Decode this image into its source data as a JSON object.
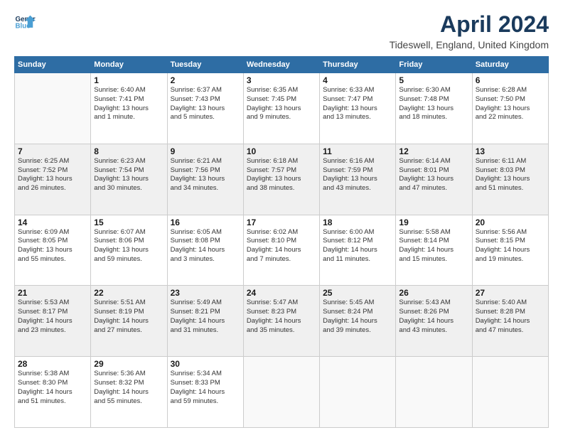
{
  "header": {
    "logo_line1": "General",
    "logo_line2": "Blue",
    "title": "April 2024",
    "subtitle": "Tideswell, England, United Kingdom"
  },
  "days_of_week": [
    "Sunday",
    "Monday",
    "Tuesday",
    "Wednesday",
    "Thursday",
    "Friday",
    "Saturday"
  ],
  "weeks": [
    [
      {
        "day": "",
        "info": ""
      },
      {
        "day": "1",
        "info": "Sunrise: 6:40 AM\nSunset: 7:41 PM\nDaylight: 13 hours\nand 1 minute."
      },
      {
        "day": "2",
        "info": "Sunrise: 6:37 AM\nSunset: 7:43 PM\nDaylight: 13 hours\nand 5 minutes."
      },
      {
        "day": "3",
        "info": "Sunrise: 6:35 AM\nSunset: 7:45 PM\nDaylight: 13 hours\nand 9 minutes."
      },
      {
        "day": "4",
        "info": "Sunrise: 6:33 AM\nSunset: 7:47 PM\nDaylight: 13 hours\nand 13 minutes."
      },
      {
        "day": "5",
        "info": "Sunrise: 6:30 AM\nSunset: 7:48 PM\nDaylight: 13 hours\nand 18 minutes."
      },
      {
        "day": "6",
        "info": "Sunrise: 6:28 AM\nSunset: 7:50 PM\nDaylight: 13 hours\nand 22 minutes."
      }
    ],
    [
      {
        "day": "7",
        "info": "Sunrise: 6:25 AM\nSunset: 7:52 PM\nDaylight: 13 hours\nand 26 minutes."
      },
      {
        "day": "8",
        "info": "Sunrise: 6:23 AM\nSunset: 7:54 PM\nDaylight: 13 hours\nand 30 minutes."
      },
      {
        "day": "9",
        "info": "Sunrise: 6:21 AM\nSunset: 7:56 PM\nDaylight: 13 hours\nand 34 minutes."
      },
      {
        "day": "10",
        "info": "Sunrise: 6:18 AM\nSunset: 7:57 PM\nDaylight: 13 hours\nand 38 minutes."
      },
      {
        "day": "11",
        "info": "Sunrise: 6:16 AM\nSunset: 7:59 PM\nDaylight: 13 hours\nand 43 minutes."
      },
      {
        "day": "12",
        "info": "Sunrise: 6:14 AM\nSunset: 8:01 PM\nDaylight: 13 hours\nand 47 minutes."
      },
      {
        "day": "13",
        "info": "Sunrise: 6:11 AM\nSunset: 8:03 PM\nDaylight: 13 hours\nand 51 minutes."
      }
    ],
    [
      {
        "day": "14",
        "info": "Sunrise: 6:09 AM\nSunset: 8:05 PM\nDaylight: 13 hours\nand 55 minutes."
      },
      {
        "day": "15",
        "info": "Sunrise: 6:07 AM\nSunset: 8:06 PM\nDaylight: 13 hours\nand 59 minutes."
      },
      {
        "day": "16",
        "info": "Sunrise: 6:05 AM\nSunset: 8:08 PM\nDaylight: 14 hours\nand 3 minutes."
      },
      {
        "day": "17",
        "info": "Sunrise: 6:02 AM\nSunset: 8:10 PM\nDaylight: 14 hours\nand 7 minutes."
      },
      {
        "day": "18",
        "info": "Sunrise: 6:00 AM\nSunset: 8:12 PM\nDaylight: 14 hours\nand 11 minutes."
      },
      {
        "day": "19",
        "info": "Sunrise: 5:58 AM\nSunset: 8:14 PM\nDaylight: 14 hours\nand 15 minutes."
      },
      {
        "day": "20",
        "info": "Sunrise: 5:56 AM\nSunset: 8:15 PM\nDaylight: 14 hours\nand 19 minutes."
      }
    ],
    [
      {
        "day": "21",
        "info": "Sunrise: 5:53 AM\nSunset: 8:17 PM\nDaylight: 14 hours\nand 23 minutes."
      },
      {
        "day": "22",
        "info": "Sunrise: 5:51 AM\nSunset: 8:19 PM\nDaylight: 14 hours\nand 27 minutes."
      },
      {
        "day": "23",
        "info": "Sunrise: 5:49 AM\nSunset: 8:21 PM\nDaylight: 14 hours\nand 31 minutes."
      },
      {
        "day": "24",
        "info": "Sunrise: 5:47 AM\nSunset: 8:23 PM\nDaylight: 14 hours\nand 35 minutes."
      },
      {
        "day": "25",
        "info": "Sunrise: 5:45 AM\nSunset: 8:24 PM\nDaylight: 14 hours\nand 39 minutes."
      },
      {
        "day": "26",
        "info": "Sunrise: 5:43 AM\nSunset: 8:26 PM\nDaylight: 14 hours\nand 43 minutes."
      },
      {
        "day": "27",
        "info": "Sunrise: 5:40 AM\nSunset: 8:28 PM\nDaylight: 14 hours\nand 47 minutes."
      }
    ],
    [
      {
        "day": "28",
        "info": "Sunrise: 5:38 AM\nSunset: 8:30 PM\nDaylight: 14 hours\nand 51 minutes."
      },
      {
        "day": "29",
        "info": "Sunrise: 5:36 AM\nSunset: 8:32 PM\nDaylight: 14 hours\nand 55 minutes."
      },
      {
        "day": "30",
        "info": "Sunrise: 5:34 AM\nSunset: 8:33 PM\nDaylight: 14 hours\nand 59 minutes."
      },
      {
        "day": "",
        "info": ""
      },
      {
        "day": "",
        "info": ""
      },
      {
        "day": "",
        "info": ""
      },
      {
        "day": "",
        "info": ""
      }
    ]
  ]
}
